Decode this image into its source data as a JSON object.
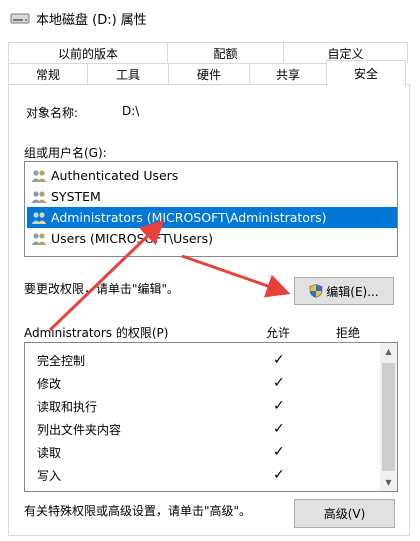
{
  "window": {
    "title": "本地磁盘 (D:) 属性"
  },
  "tabs": {
    "back": [
      "以前的版本",
      "配额",
      "自定义"
    ],
    "front": [
      "常规",
      "工具",
      "硬件",
      "共享",
      "安全"
    ],
    "active": "安全"
  },
  "object": {
    "label": "对象名称:",
    "value": "D:\\"
  },
  "groups": {
    "label": "组或用户名(G):",
    "items": [
      {
        "name": "Authenticated Users",
        "selected": false
      },
      {
        "name": "SYSTEM",
        "selected": false
      },
      {
        "name": "Administrators (MICROSOFT\\Administrators)",
        "selected": true
      },
      {
        "name": "Users (MICROSOFT\\Users)",
        "selected": false
      }
    ]
  },
  "change": {
    "note": "要更改权限，请单击\"编辑\"。",
    "edit_button": "编辑(E)..."
  },
  "permissions": {
    "title": "Administrators 的权限(P)",
    "allow_header": "允许",
    "deny_header": "拒绝",
    "rows": [
      {
        "name": "完全控制",
        "allow": "✓"
      },
      {
        "name": "修改",
        "allow": "✓"
      },
      {
        "name": "读取和执行",
        "allow": "✓"
      },
      {
        "name": "列出文件夹内容",
        "allow": "✓"
      },
      {
        "name": "读取",
        "allow": "✓"
      },
      {
        "name": "写入",
        "allow": "✓"
      }
    ]
  },
  "advanced": {
    "note": "有关特殊权限或高级设置，请单击\"高级\"。",
    "button": "高级(V)"
  },
  "colors": {
    "selection": "#0078d7",
    "annotation_arrow": "#e8413c",
    "shield_blue": "#2e6fd6",
    "shield_yellow": "#f2c230"
  },
  "icons": {
    "drive": "drive-icon",
    "user_group": "user-group-icon",
    "shield": "uac-shield-icon"
  }
}
